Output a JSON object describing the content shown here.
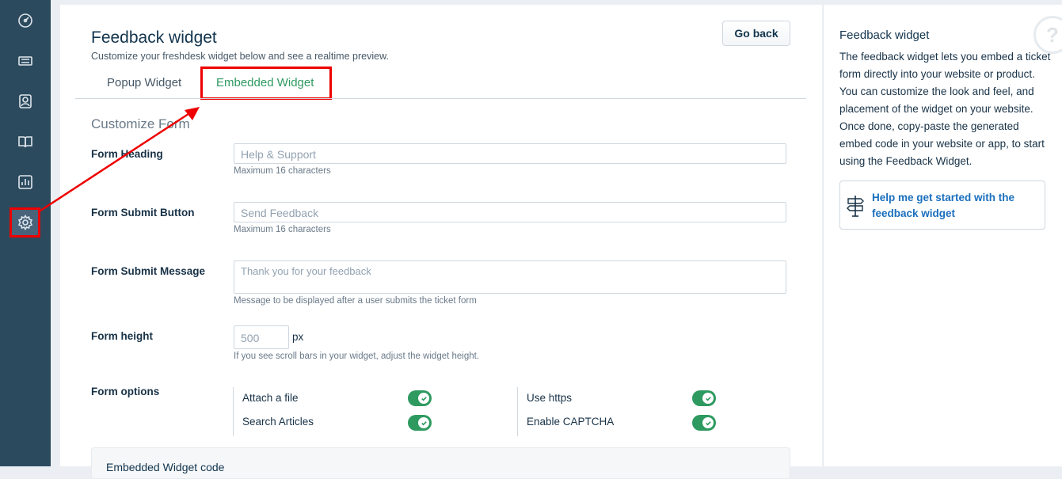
{
  "sidebar": {
    "items": [
      {
        "name": "dashboard",
        "icon": "dashboard-icon"
      },
      {
        "name": "tickets",
        "icon": "ticket-icon"
      },
      {
        "name": "contacts",
        "icon": "contact-icon"
      },
      {
        "name": "solutions",
        "icon": "book-icon"
      },
      {
        "name": "reports",
        "icon": "reports-icon"
      },
      {
        "name": "admin",
        "icon": "gear-icon"
      }
    ]
  },
  "header": {
    "title": "Feedback widget",
    "subtitle": "Customize your freshdesk widget below and see a realtime preview.",
    "go_back": "Go back"
  },
  "tabs": [
    "Popup Widget",
    "Embedded Widget"
  ],
  "form": {
    "section_title": "Customize Form",
    "heading": {
      "label": "Form Heading",
      "placeholder": "Help & Support",
      "help": "Maximum 16 characters"
    },
    "submit_button": {
      "label": "Form Submit Button",
      "placeholder": "Send Feedback",
      "help": "Maximum 16 characters"
    },
    "submit_message": {
      "label": "Form Submit Message",
      "placeholder": "Thank you for your feedback",
      "help": "Message to be displayed after a user submits the ticket form"
    },
    "height": {
      "label": "Form height",
      "placeholder": "500",
      "unit": "px",
      "help": "If you see scroll bars in your widget, adjust the widget height."
    },
    "options": {
      "label": "Form options",
      "items": [
        {
          "label": "Attach a file",
          "on": true
        },
        {
          "label": "Search Articles",
          "on": true
        },
        {
          "label": "Use https",
          "on": true
        },
        {
          "label": "Enable CAPTCHA",
          "on": true
        }
      ]
    },
    "embed_code_title": "Embedded Widget code"
  },
  "right_panel": {
    "title": "Feedback widget",
    "description": "The feedback widget lets you embed a ticket form directly into your website or product. You can customize the look and feel, and placement of the widget on your website. Once done, copy-paste the generated embed code in your website or app, to start using the Feedback Widget.",
    "help_link": "Help me get started with the feedback widget",
    "help_icon": "?"
  },
  "colors": {
    "sidebar": "#2c4a5e",
    "accent_green": "#2e9a60",
    "link_blue": "#1a6fbd",
    "annotation_red": "#e00000"
  }
}
